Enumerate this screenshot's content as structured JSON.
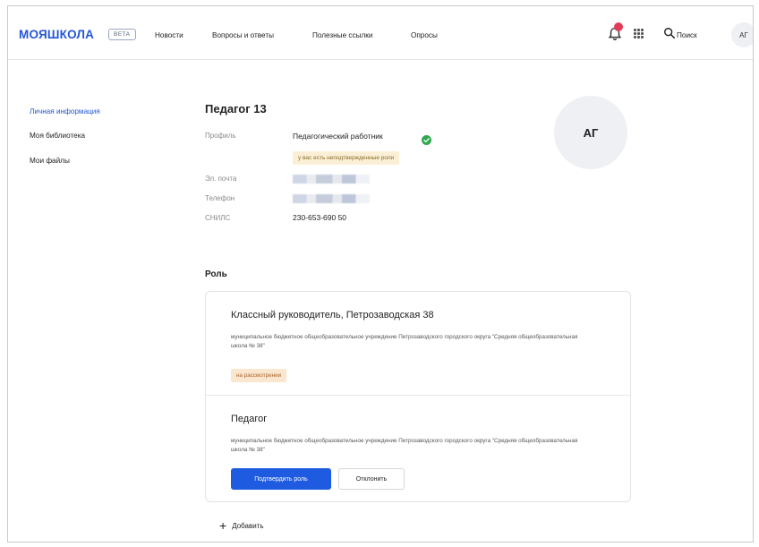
{
  "header": {
    "logo": "МОЯШКОЛА",
    "beta": "BETA",
    "nav": [
      "Новости",
      "Вопросы и ответы",
      "Полезные ссылки",
      "Опросы"
    ],
    "search_label": "Поиск",
    "user_initials": "АГ"
  },
  "sidebar": {
    "items": [
      {
        "label": "Личная информация",
        "active": true
      },
      {
        "label": "Моя библиотека",
        "active": false
      },
      {
        "label": "Мои файлы",
        "active": false
      }
    ]
  },
  "profile": {
    "title": "Педагог 13",
    "avatar_initials": "АГ",
    "profile_label": "Профиль",
    "profile_value": "Педагогический работник",
    "warning": "у вас есть неподтвержденные роли",
    "email_label": "Эл. почта",
    "phone_label": "Телефон",
    "snils_label": "СНИЛС",
    "snils_value": "230-653-690 50"
  },
  "roles": {
    "section_title": "Роль",
    "items": [
      {
        "title": "Классный руководитель, Петрозаводская 38",
        "description": "муниципальное бюджетное общеобразовательное учреждение Петрозаводского городского округа \"Средняя общеобразовательная школа № 38\"",
        "status": "на рассмотрении"
      },
      {
        "title": "Педагог",
        "description": "муниципальное бюджетное общеобразовательное учреждение Петрозаводского городского округа \"Средняя общеобразовательная школа № 38\"",
        "confirm_label": "Подтвердить роль",
        "reject_label": "Отклонить"
      }
    ],
    "add_label": "Добавить"
  },
  "colors": {
    "accent": "#2356d6",
    "primary_button": "#1f5be0",
    "notification_badge": "#e03c5a",
    "verified": "#2fa84f",
    "warning_bg": "#fbf0d6",
    "status_bg": "#fbe6cf"
  },
  "icons": {
    "bell": "bell-icon",
    "apps": "apps-grid-icon",
    "search": "search-icon",
    "verified": "check-circle-icon",
    "add": "plus-icon"
  }
}
